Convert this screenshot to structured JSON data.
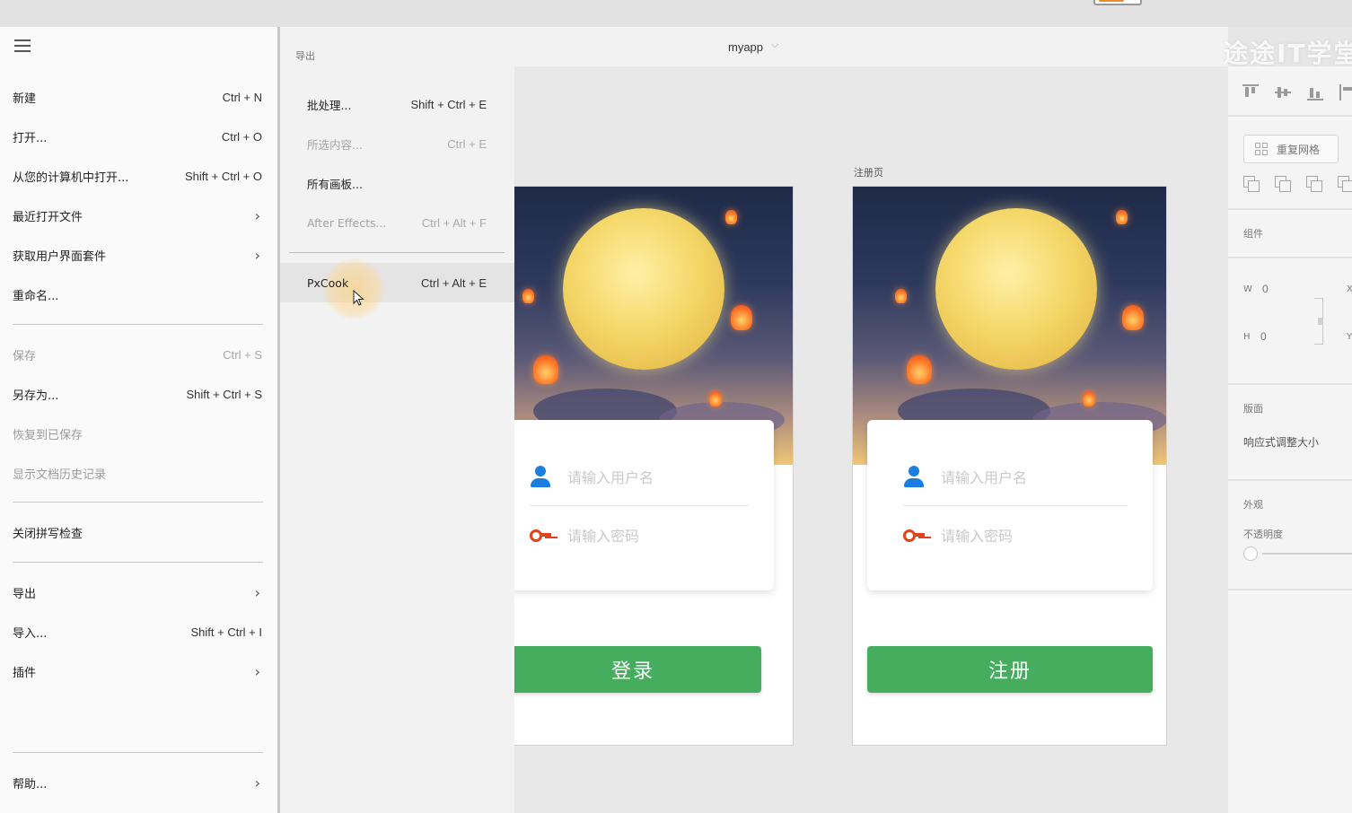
{
  "main_menu": {
    "items": [
      {
        "label": "新建",
        "shortcut": "Ctrl + N"
      },
      {
        "label": "打开...",
        "shortcut": "Ctrl + O"
      },
      {
        "label": "从您的计算机中打开...",
        "shortcut": "Shift + Ctrl + O"
      },
      {
        "label": "最近打开文件"
      },
      {
        "label": "获取用户界面套件"
      },
      {
        "label": "重命名..."
      },
      {
        "label": "保存",
        "shortcut": "Ctrl + S"
      },
      {
        "label": "另存为...",
        "shortcut": "Shift + Ctrl + S"
      },
      {
        "label": "恢复到已保存"
      },
      {
        "label": "显示文档历史记录"
      },
      {
        "label": "关闭拼写检查"
      },
      {
        "label": "导出"
      },
      {
        "label": "导入...",
        "shortcut": "Shift + Ctrl + I"
      },
      {
        "label": "插件"
      },
      {
        "label": "帮助..."
      }
    ]
  },
  "export_submenu": {
    "title": "导出",
    "items": [
      {
        "label": "批处理...",
        "shortcut": "Shift + Ctrl + E"
      },
      {
        "label": "所选内容...",
        "shortcut": "Ctrl + E"
      },
      {
        "label": "所有画板..."
      },
      {
        "label": "After Effects...",
        "shortcut": "Ctrl + Alt + F"
      },
      {
        "label": "PxCook",
        "shortcut": "Ctrl + Alt + E"
      }
    ]
  },
  "document": {
    "title": "myapp",
    "watermark": "途途IT学堂"
  },
  "artboards": [
    {
      "username_placeholder": "请输入用户名",
      "password_placeholder": "请输入密码",
      "button_label": "登录"
    },
    {
      "label": "注册页",
      "username_placeholder": "请输入用户名",
      "password_placeholder": "请输入密码",
      "button_label": "注册"
    }
  ],
  "properties": {
    "repeat_grid": "重复网格",
    "component_title": "组件",
    "w_label": "W",
    "w_value": "0",
    "h_label": "H",
    "h_value": "0",
    "x_label": "X",
    "y_label": "Y",
    "layout_title": "版面",
    "responsive_resize": "响应式调整大小",
    "appearance_title": "外观",
    "opacity_label": "不透明度"
  },
  "colors": {
    "button_green": "#46ad5f",
    "user_icon_blue": "#1a7fe0",
    "key_icon_red": "#e2421c",
    "cursor_highlight": "#ffcf78"
  }
}
